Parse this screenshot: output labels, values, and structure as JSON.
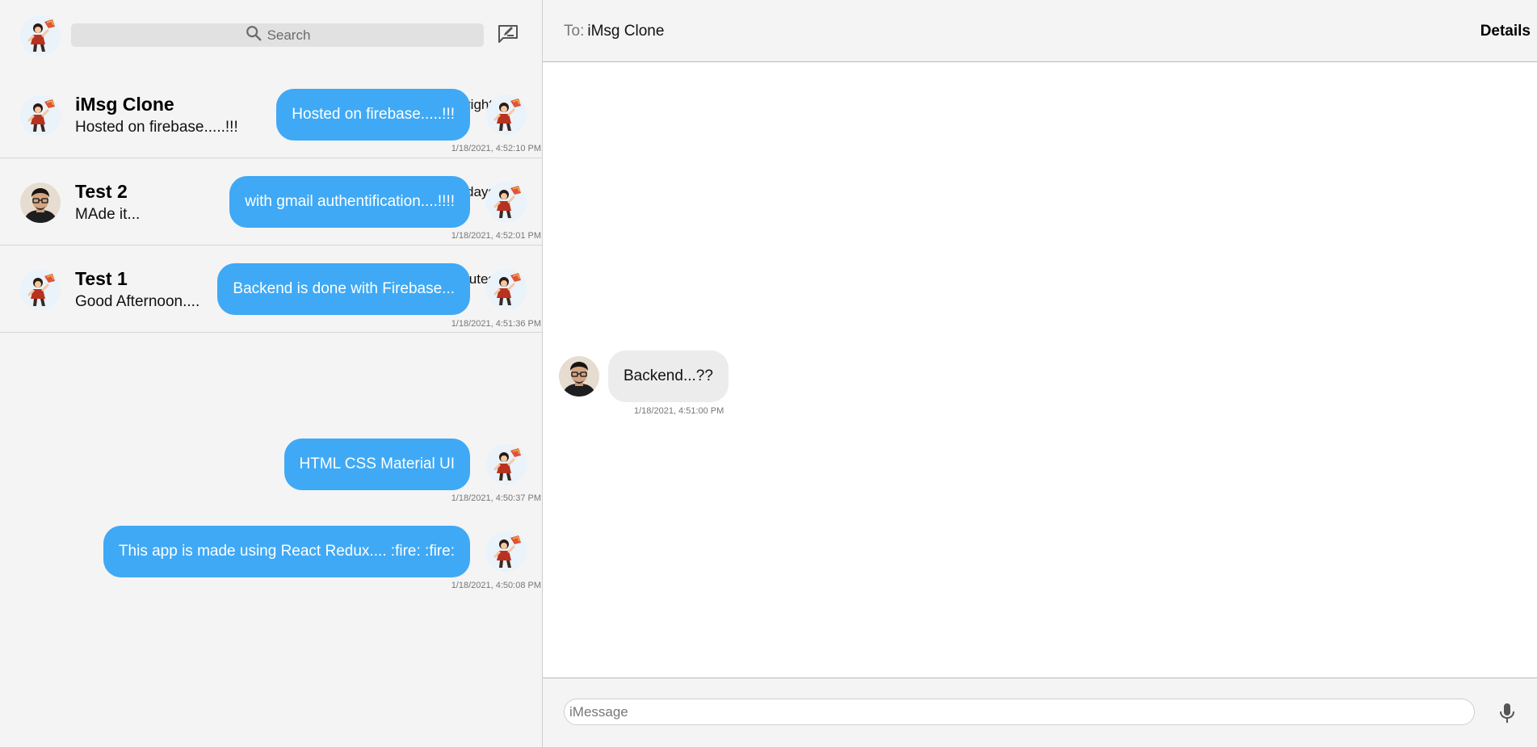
{
  "sidebar": {
    "search_placeholder": "Search",
    "chats": [
      {
        "name": "iMsg Clone",
        "time": "right now",
        "preview": "Hosted on firebase.....!!!",
        "avatar": "cartoon-avatar"
      },
      {
        "name": "Test 2",
        "time": "5 days ago",
        "preview": "MAde it...",
        "avatar": "person-avatar"
      },
      {
        "name": "Test 1",
        "time": "3 minutes ago",
        "preview": "Good Afternoon....",
        "avatar": "cartoon-avatar"
      }
    ]
  },
  "header": {
    "to_label": "To:",
    "recipient": "iMsg Clone",
    "details_label": "Details"
  },
  "messages": [
    {
      "text": "Hosted on firebase.....!!!",
      "timestamp": "1/18/2021, 4:52:10 PM",
      "direction": "sent"
    },
    {
      "text": "with gmail authentification....!!!!",
      "timestamp": "1/18/2021, 4:52:01 PM",
      "direction": "sent"
    },
    {
      "text": "Backend is done with Firebase...",
      "timestamp": "1/18/2021, 4:51:36 PM",
      "direction": "sent"
    },
    {
      "text": "Backend...??",
      "timestamp": "1/18/2021, 4:51:00 PM",
      "direction": "received"
    },
    {
      "text": "HTML CSS Material UI",
      "timestamp": "1/18/2021, 4:50:37 PM",
      "direction": "sent"
    },
    {
      "text": "This app is made using React Redux.... :fire: :fire:",
      "timestamp": "1/18/2021, 4:50:08 PM",
      "direction": "sent"
    }
  ],
  "composer": {
    "placeholder": "iMessage"
  },
  "icons": {
    "search": "search-icon",
    "compose": "compose-icon",
    "mic": "mic-icon"
  },
  "colors": {
    "sent_bubble": "#3fa9f5",
    "received_bubble": "#ececec",
    "sidebar_bg": "#f4f4f4"
  }
}
